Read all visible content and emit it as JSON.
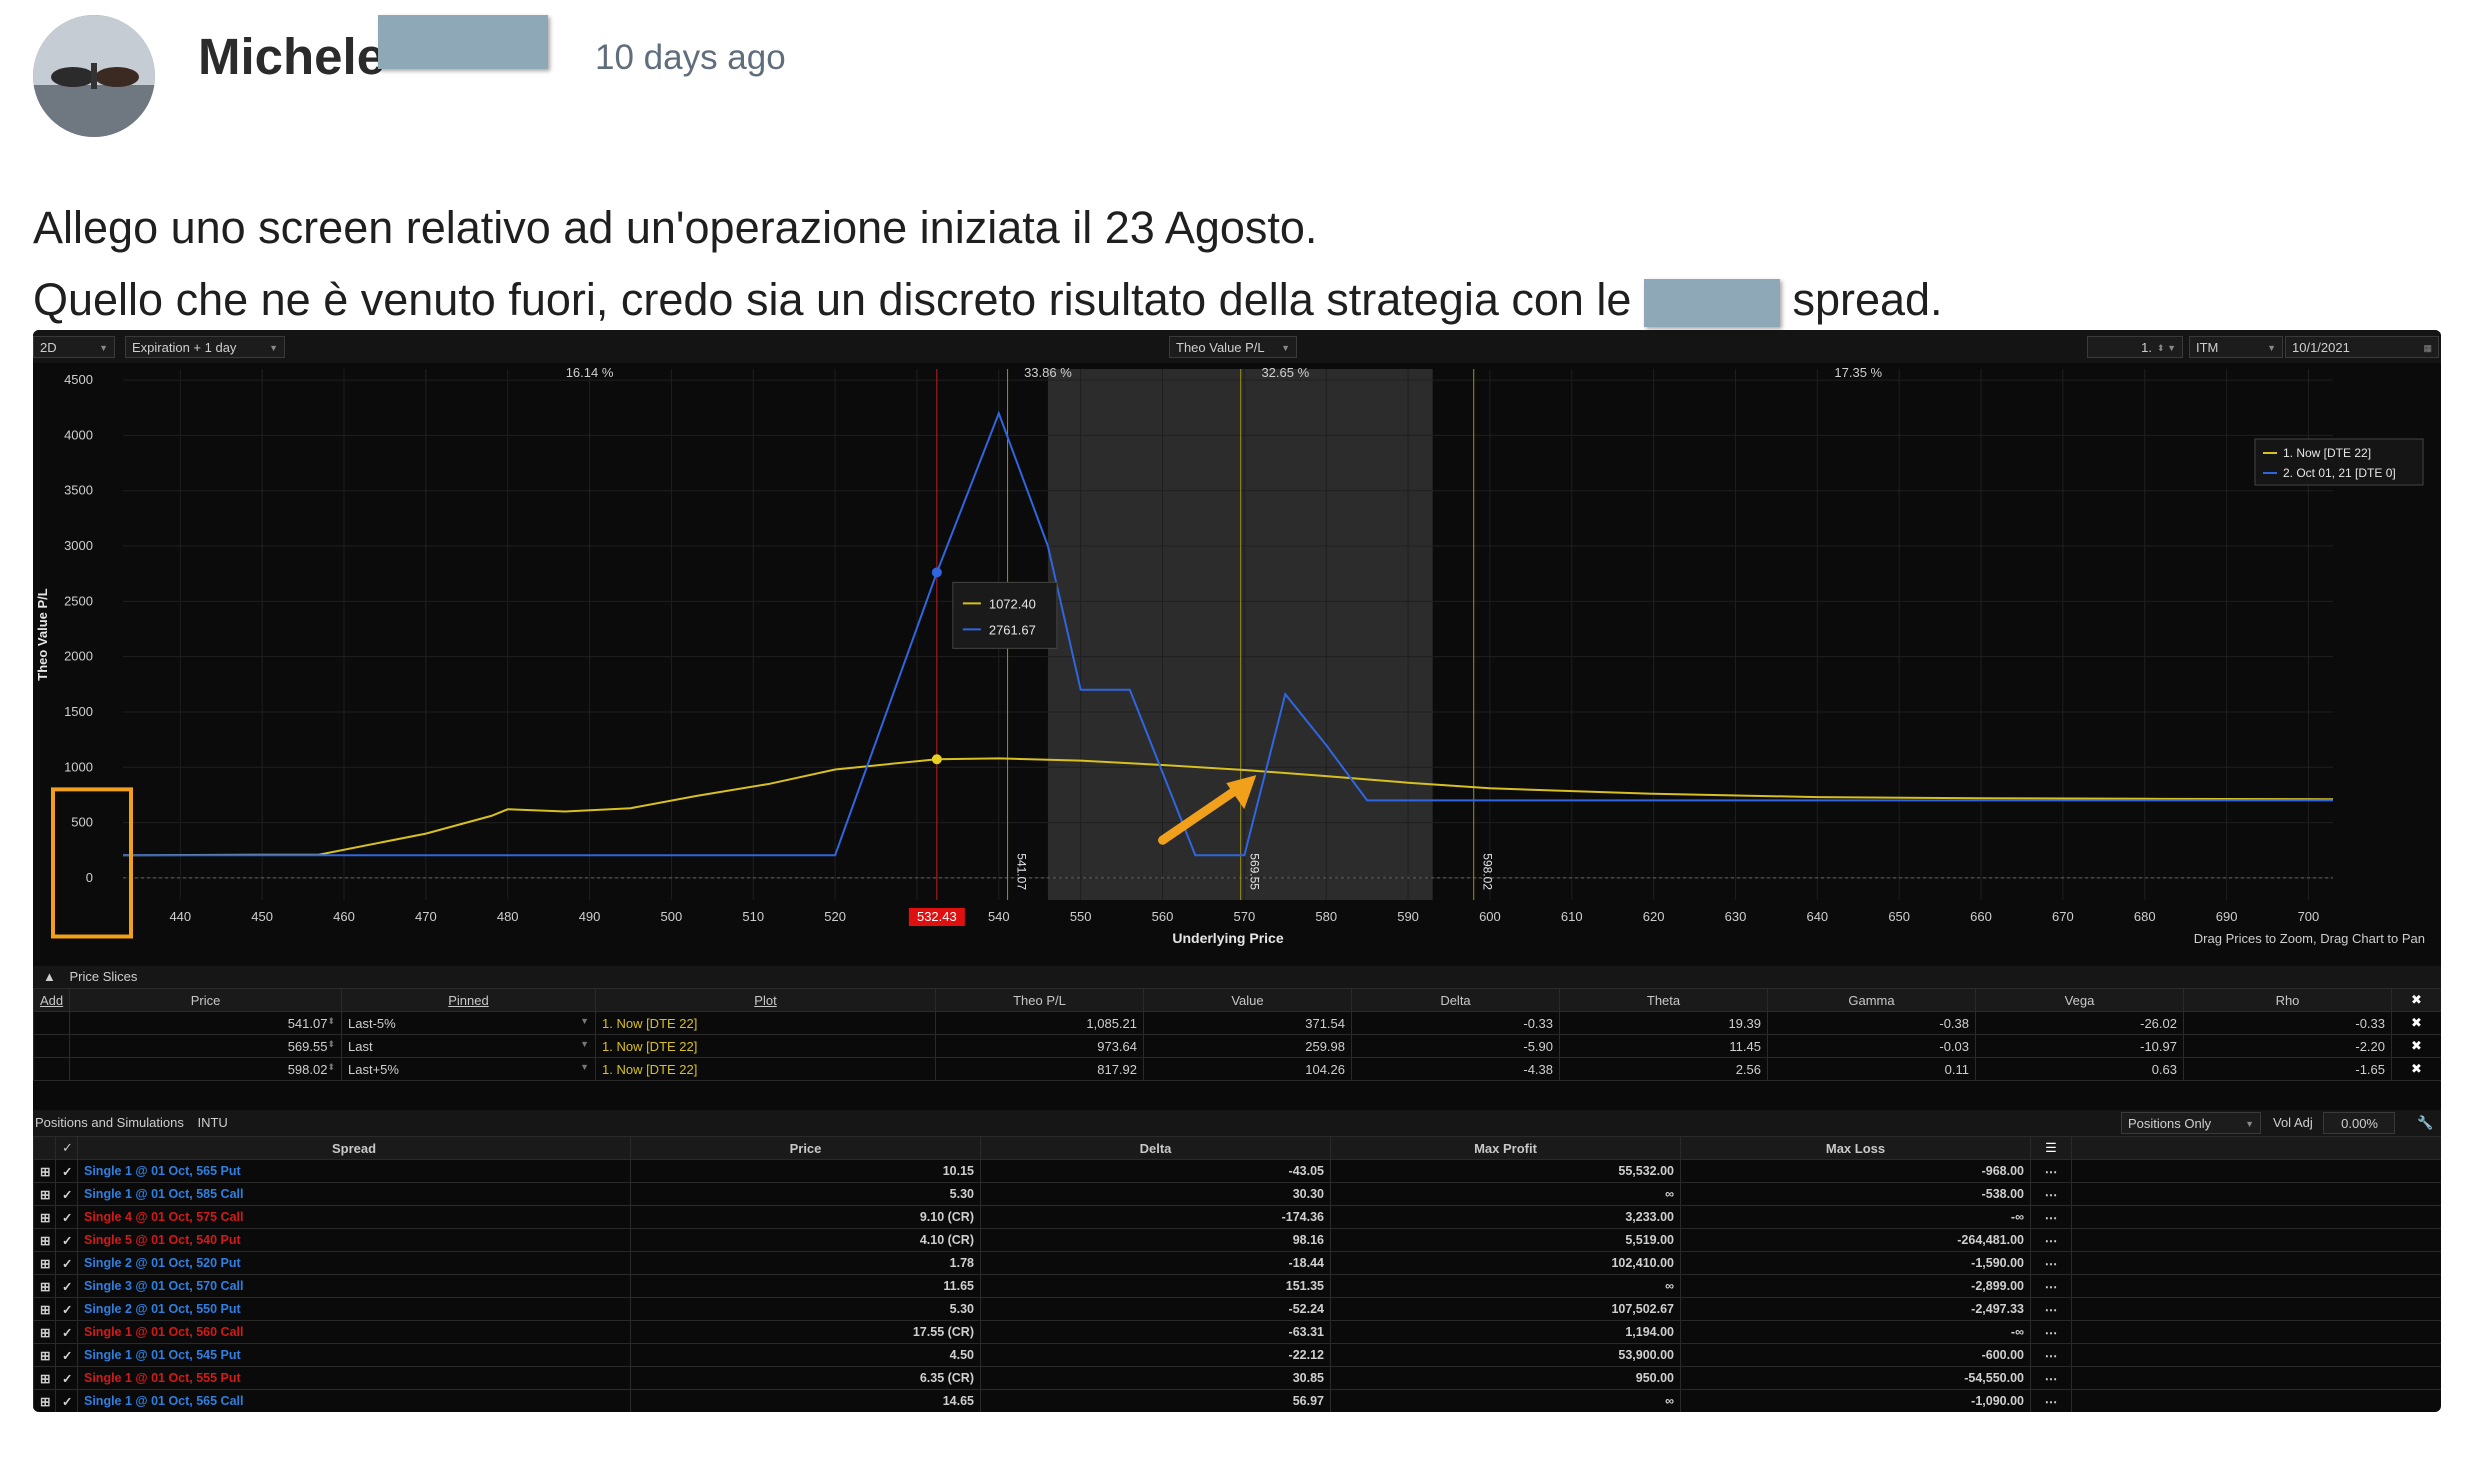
{
  "post": {
    "author": "Michele",
    "timestamp": "10 days ago",
    "line1": "Allego uno screen relativo ad un'operazione iniziata il 23 Agosto.",
    "line2_start": "Quello che ne è venuto fuori, credo sia un discreto risultato della strategia con le",
    "line2_end": "spread."
  },
  "toolbar": {
    "view": "2D",
    "expiration": "Expiration + 1 day",
    "metric": "Theo Value P/L",
    "count": "1.",
    "moneyness": "ITM",
    "date": "10/1/2021"
  },
  "chart_data": {
    "type": "line",
    "ylabel": "Theo Value P/L",
    "xlabel": "Underlying Price",
    "xlim": [
      433,
      703
    ],
    "ylim": [
      -200,
      4600
    ],
    "x_ticks": [
      440,
      450,
      460,
      470,
      480,
      490,
      500,
      510,
      520,
      530,
      540,
      550,
      560,
      570,
      580,
      590,
      600,
      610,
      620,
      630,
      640,
      650,
      660,
      670,
      680,
      690,
      700
    ],
    "y_ticks": [
      0,
      500,
      1000,
      1500,
      2000,
      2500,
      3000,
      3500,
      4000,
      4500
    ],
    "current_price_label": "532.43",
    "current_price": 532.43,
    "vlines": [
      541.07,
      569.55,
      598.02
    ],
    "vline_labels": [
      "541.07",
      "569.55",
      "598.02"
    ],
    "shaded_range": [
      546,
      593
    ],
    "probabilities": [
      "16.14 %",
      "33.86 %",
      "32.65 %",
      "17.35 %"
    ],
    "probability_x": [
      490,
      546,
      575,
      645
    ],
    "series": [
      {
        "name": "1. Now [DTE 22]",
        "color": "#d8c020",
        "x": [
          433,
          457,
          470,
          478,
          480,
          487,
          495,
          503,
          512,
          520,
          532.43,
          540,
          550,
          560,
          570,
          580,
          590,
          600,
          620,
          640,
          660,
          680,
          703
        ],
        "y": [
          205,
          210,
          400,
          560,
          620,
          600,
          630,
          740,
          850,
          980,
          1072.4,
          1080,
          1060,
          1020,
          975,
          920,
          860,
          810,
          760,
          730,
          720,
          715,
          710
        ]
      },
      {
        "name": "2. Oct 01, 21 [DTE 0]",
        "color": "#2f66e0",
        "x": [
          433,
          520,
          532.43,
          540,
          546,
          550,
          556,
          564,
          570,
          575,
          580,
          585,
          600,
          620,
          650,
          703
        ],
        "y": [
          205,
          205,
          2761.67,
          4200,
          3000,
          1700,
          1700,
          205,
          205,
          1660,
          1200,
          700,
          700,
          700,
          700,
          700
        ]
      }
    ],
    "tooltip": {
      "now": "1072.40",
      "exp": "2761.67"
    },
    "note": "Drag Prices to Zoom, Drag Chart to Pan"
  },
  "price_slices": {
    "title": "Price Slices",
    "columns": [
      "Add",
      "Price",
      "Pinned",
      "Plot",
      "Theo P/L",
      "Value",
      "Delta",
      "Theta",
      "Gamma",
      "Vega",
      "Rho"
    ],
    "rows": [
      [
        "541.07",
        "Last-5%",
        "1. Now [DTE 22]",
        "1,085.21",
        "371.54",
        "-0.33",
        "19.39",
        "-0.38",
        "-26.02",
        "-0.33"
      ],
      [
        "569.55",
        "Last",
        "1. Now [DTE 22]",
        "973.64",
        "259.98",
        "-5.90",
        "11.45",
        "-0.03",
        "-10.97",
        "-2.20"
      ],
      [
        "598.02",
        "Last+5%",
        "1. Now [DTE 22]",
        "817.92",
        "104.26",
        "-4.38",
        "2.56",
        "0.11",
        "0.63",
        "-1.65"
      ]
    ]
  },
  "positions": {
    "title": "Positions and Simulations",
    "symbol": "INTU",
    "filter": "Positions Only",
    "vol_adj_label": "Vol Adj",
    "vol_adj": "0.00%",
    "columns": [
      "Spread",
      "Price",
      "Delta",
      "Max Profit",
      "Max Loss"
    ],
    "rows": [
      {
        "spread": "Single 1 @ 01 Oct, 565 Put",
        "side": "buy",
        "price": "10.15",
        "delta": "-43.05",
        "max_profit": "55,532.00",
        "max_loss": "-968.00"
      },
      {
        "spread": "Single 1 @ 01 Oct, 585 Call",
        "side": "buy",
        "price": "5.30",
        "delta": "30.30",
        "max_profit": "∞",
        "max_loss": "-538.00"
      },
      {
        "spread": "Single 4 @ 01 Oct, 575 Call",
        "side": "sell",
        "price": "9.10 (CR)",
        "delta": "-174.36",
        "max_profit": "3,233.00",
        "max_loss": "-∞"
      },
      {
        "spread": "Single 5 @ 01 Oct, 540 Put",
        "side": "sell",
        "price": "4.10 (CR)",
        "delta": "98.16",
        "max_profit": "5,519.00",
        "max_loss": "-264,481.00"
      },
      {
        "spread": "Single 2 @ 01 Oct, 520 Put",
        "side": "buy",
        "price": "1.78",
        "delta": "-18.44",
        "max_profit": "102,410.00",
        "max_loss": "-1,590.00"
      },
      {
        "spread": "Single 3 @ 01 Oct, 570 Call",
        "side": "buy",
        "price": "11.65",
        "delta": "151.35",
        "max_profit": "∞",
        "max_loss": "-2,899.00"
      },
      {
        "spread": "Single 2 @ 01 Oct, 550 Put",
        "side": "buy",
        "price": "5.30",
        "delta": "-52.24",
        "max_profit": "107,502.67",
        "max_loss": "-2,497.33"
      },
      {
        "spread": "Single 1 @ 01 Oct, 560 Call",
        "side": "sell",
        "price": "17.55 (CR)",
        "delta": "-63.31",
        "max_profit": "1,194.00",
        "max_loss": "-∞"
      },
      {
        "spread": "Single 1 @ 01 Oct, 545 Put",
        "side": "buy",
        "price": "4.50",
        "delta": "-22.12",
        "max_profit": "53,900.00",
        "max_loss": "-600.00"
      },
      {
        "spread": "Single 1 @ 01 Oct, 555 Put",
        "side": "sell",
        "price": "6.35 (CR)",
        "delta": "30.85",
        "max_profit": "950.00",
        "max_loss": "-54,550.00"
      },
      {
        "spread": "Single 1 @ 01 Oct, 565 Call",
        "side": "buy",
        "price": "14.65",
        "delta": "56.97",
        "max_profit": "∞",
        "max_loss": "-1,090.00"
      }
    ]
  }
}
